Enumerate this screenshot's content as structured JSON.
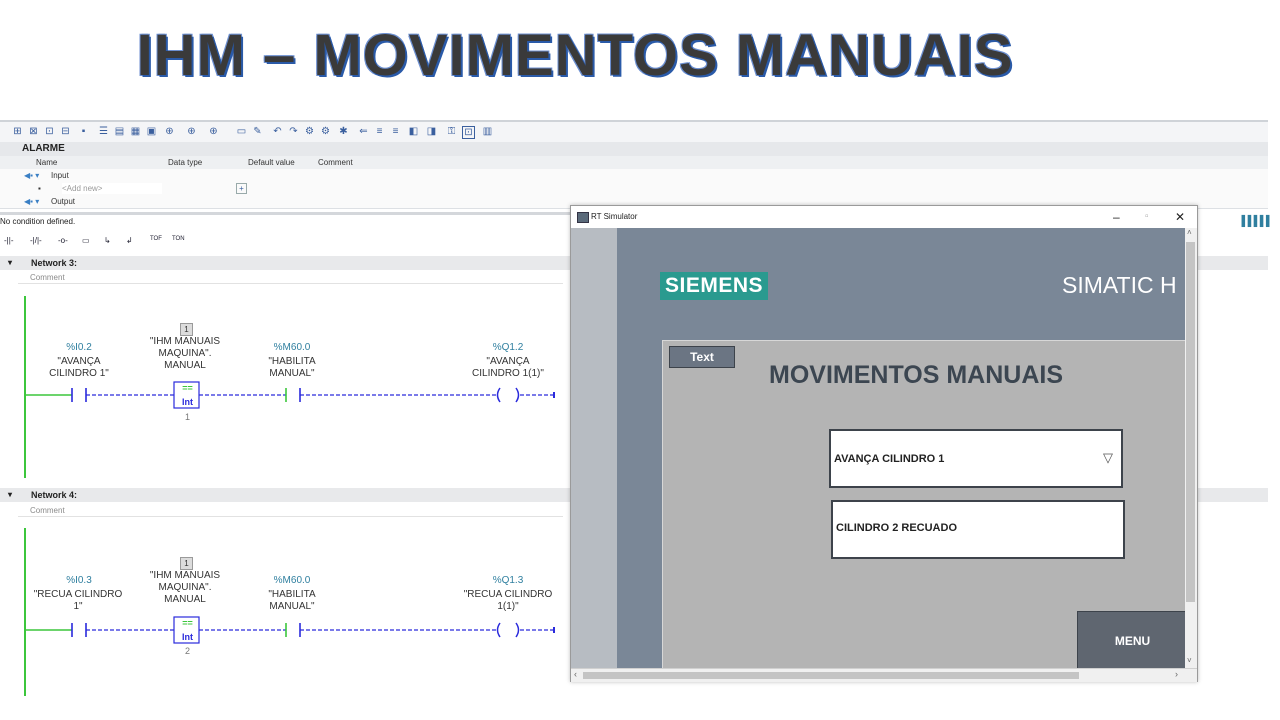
{
  "slide": {
    "title": "IHM – MOVIMENTOS MANUAIS"
  },
  "editor": {
    "block_name": "ALARME",
    "interface_table": {
      "headers": [
        "Name",
        "Data type",
        "Default value",
        "Comment"
      ],
      "rows": [
        {
          "name": "Input",
          "type": "",
          "default": "",
          "comment": ""
        },
        {
          "name": "<Add new>",
          "type": "",
          "default": "",
          "comment": ""
        },
        {
          "name": "Output",
          "type": "",
          "default": "",
          "comment": ""
        }
      ]
    },
    "condition_text": "No condition defined.",
    "lad_toolbar": [
      "-||-",
      "-|/|-",
      "-o-",
      "▭",
      "↳",
      "↲",
      "TOF",
      "TON"
    ],
    "networks": [
      {
        "title": "Network 3:",
        "comment": "Comment",
        "contact1": {
          "addr": "%I0.2",
          "label": "\"AVANÇA CILINDRO 1\""
        },
        "compare": {
          "box_number": "1",
          "label": "\"IHM MANUAIS MAQUINA\". MANUAL",
          "op": "==",
          "type": "Int",
          "value": "1"
        },
        "contact2": {
          "addr": "%M60.0",
          "label": "\"HABILITA MANUAL\""
        },
        "coil": {
          "addr": "%Q1.2",
          "label": "\"AVANÇA CILINDRO 1(1)\""
        }
      },
      {
        "title": "Network 4:",
        "comment": "Comment",
        "contact1": {
          "addr": "%I0.3",
          "label": "\"RECUA CILINDRO 1\""
        },
        "compare": {
          "box_number": "1",
          "label": "\"IHM MANUAIS MAQUINA\". MANUAL",
          "op": "==",
          "type": "Int",
          "value": "2"
        },
        "contact2": {
          "addr": "%M60.0",
          "label": "\"HABILITA MANUAL\""
        },
        "coil": {
          "addr": "%Q1.3",
          "label": "\"RECUA CILINDRO 1(1)\""
        }
      }
    ]
  },
  "simulator": {
    "window_title": "RT Simulator",
    "brand": "SIEMENS",
    "product": "SIMATIC H",
    "text_button": "Text",
    "screen_title": "MOVIMENTOS MANUAIS",
    "dropdown_value": "AVANÇA CILINDRO 1",
    "status_field": "CILINDRO 2 RECUADO",
    "menu_button": "MENU",
    "colors": {
      "brand": "#2a9a8f",
      "background": "#7a8797",
      "panel": "#b4b4b4"
    }
  }
}
